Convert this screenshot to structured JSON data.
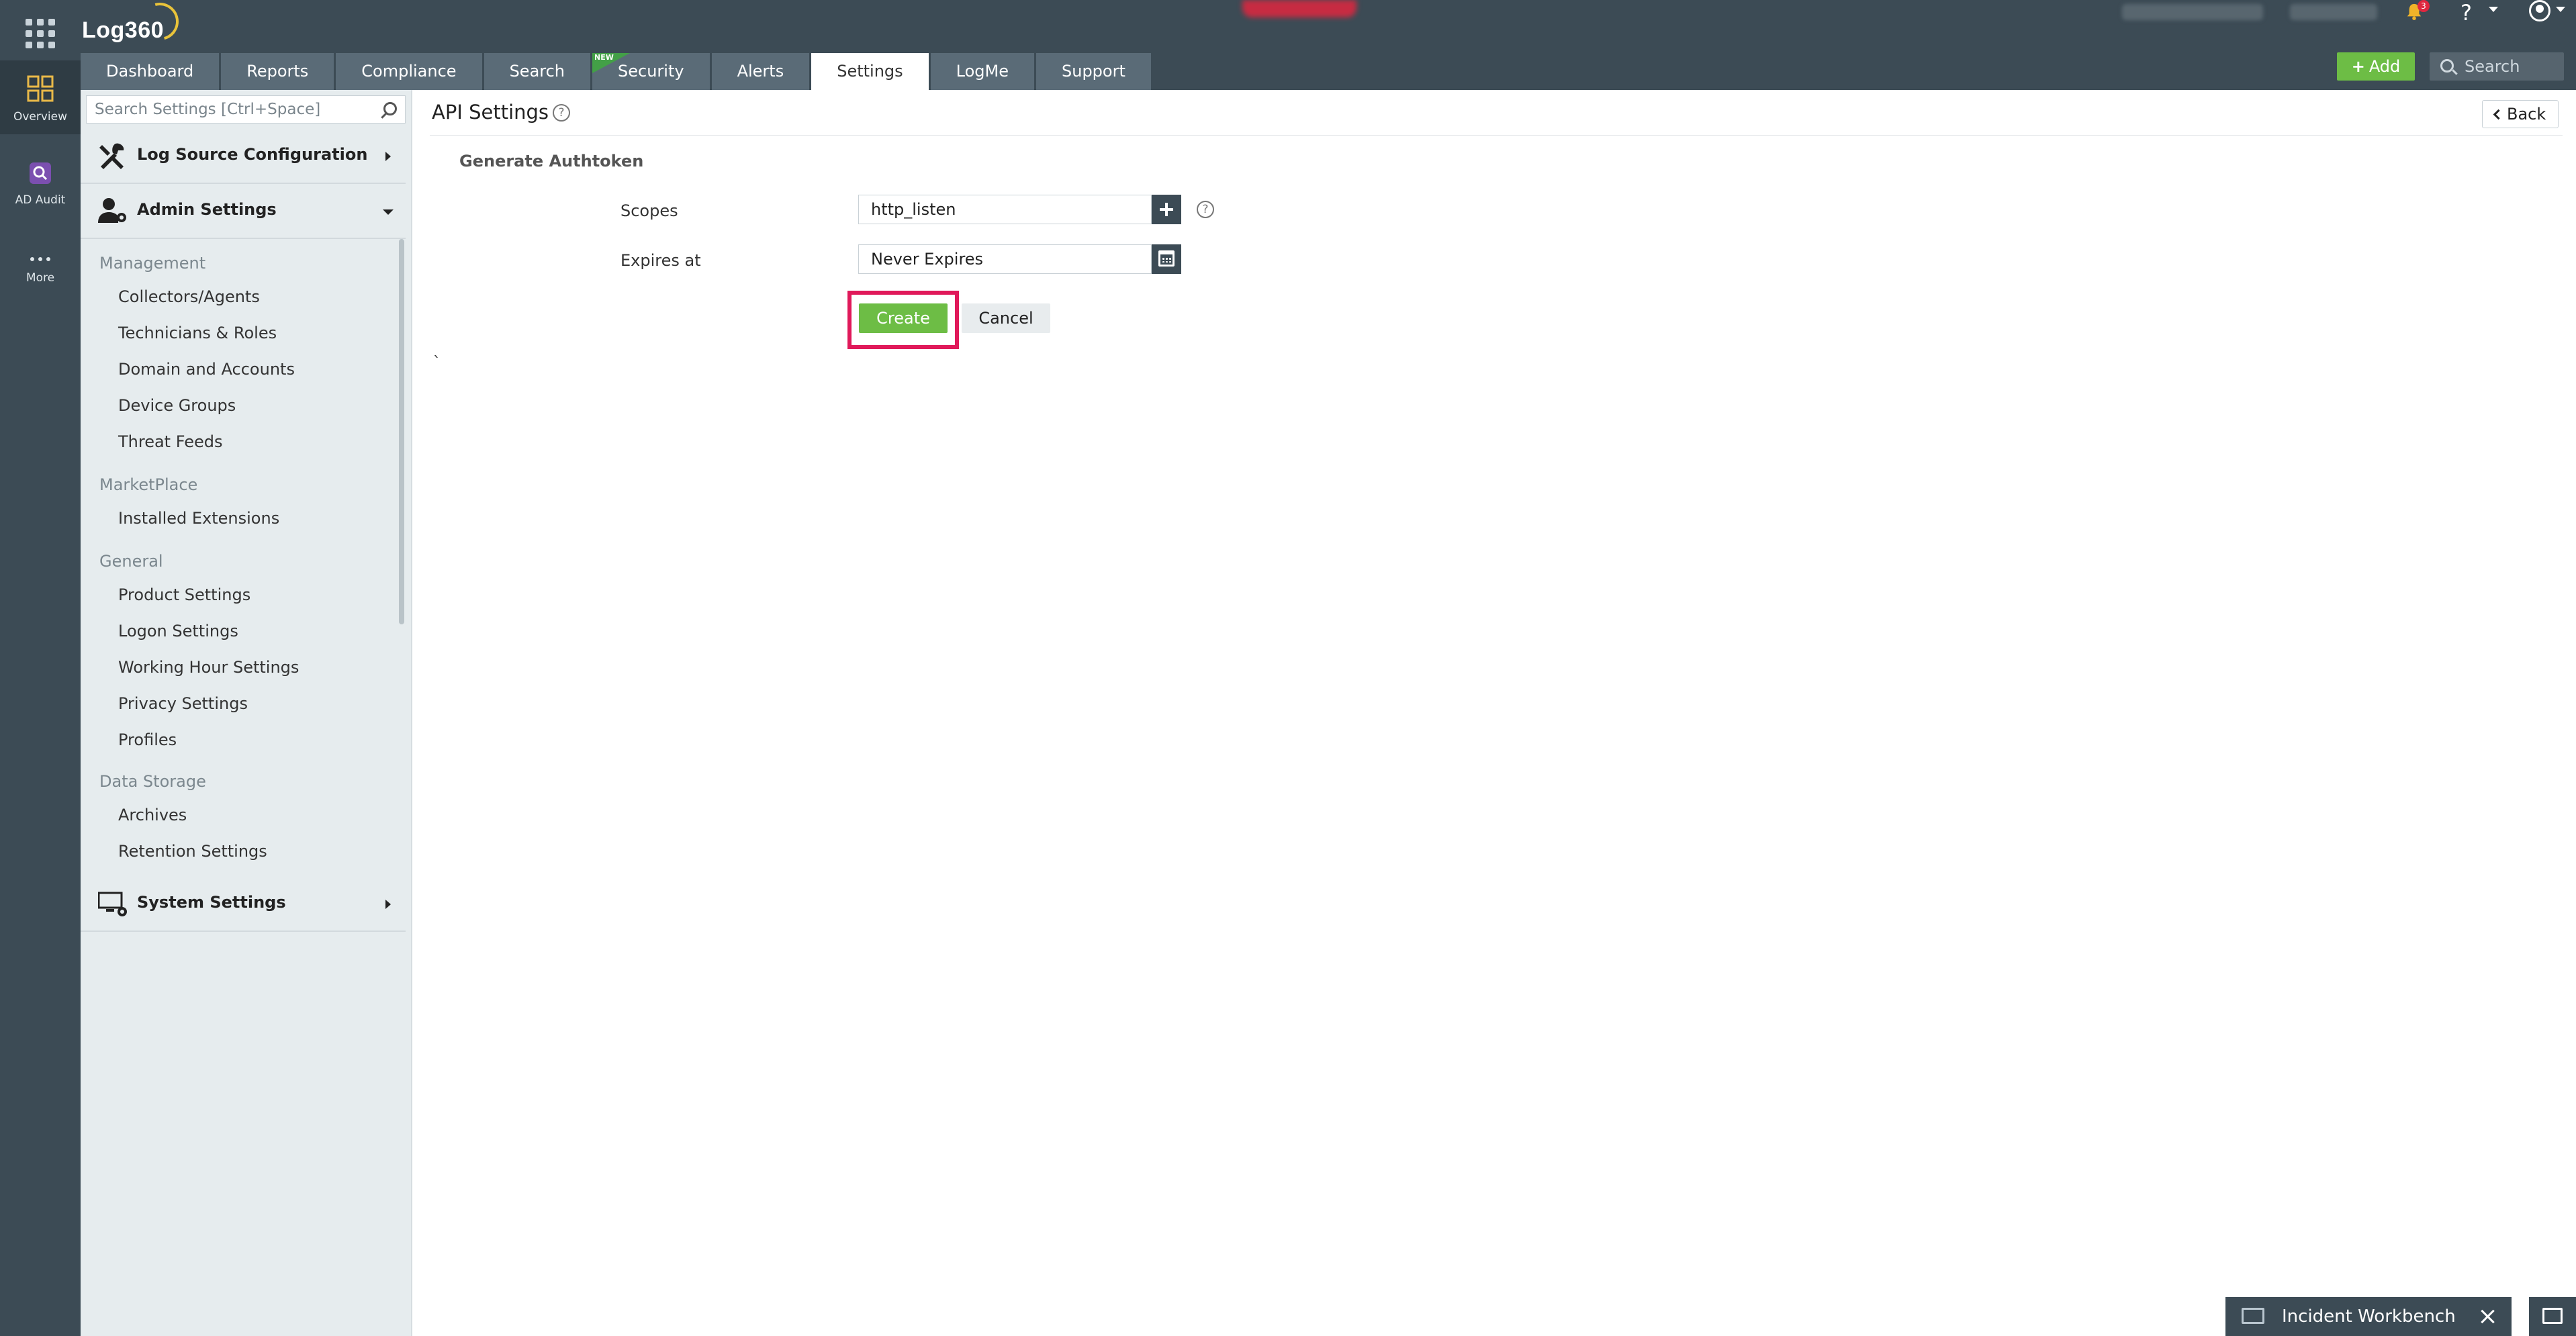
{
  "app": {
    "name": "Log360",
    "colors": {
      "header_bg": "#3c4b55",
      "tab_bg": "#5a6b77",
      "accent_green": "#6dbd45",
      "highlight_pink": "#e0195a",
      "sidebar_bg": "#e6ecee"
    }
  },
  "rail": {
    "items": [
      {
        "label": "Overview",
        "icon": "grid-dashboard-icon"
      },
      {
        "label": "AD Audit",
        "icon": "ad-audit-icon"
      },
      {
        "label": "More",
        "icon": "more-dots-icon"
      }
    ]
  },
  "topbar": {
    "notification_count": "3",
    "help_label": "?",
    "add_label": "Add",
    "search_placeholder": "Search",
    "tabs": [
      {
        "label": "Dashboard"
      },
      {
        "label": "Reports"
      },
      {
        "label": "Compliance"
      },
      {
        "label": "Search"
      },
      {
        "label": "Security",
        "badge": "NEW"
      },
      {
        "label": "Alerts"
      },
      {
        "label": "Settings",
        "active": true
      },
      {
        "label": "LogMe"
      },
      {
        "label": "Support"
      }
    ]
  },
  "sidebar": {
    "search_placeholder": "Search Settings [Ctrl+Space]",
    "sections": {
      "log_source": "Log Source Configuration",
      "admin": "Admin Settings",
      "system": "System Settings"
    },
    "groups": [
      {
        "label": "Management",
        "items": [
          "Collectors/Agents",
          "Technicians & Roles",
          "Domain and Accounts",
          "Device Groups",
          "Threat Feeds"
        ]
      },
      {
        "label": "MarketPlace",
        "items": [
          "Installed Extensions"
        ]
      },
      {
        "label": "General",
        "items": [
          "Product Settings",
          "Logon Settings",
          "Working Hour Settings",
          "Privacy Settings",
          "Profiles"
        ]
      },
      {
        "label": "Data Storage",
        "items": [
          "Archives",
          "Retention Settings"
        ]
      }
    ]
  },
  "main": {
    "title": "API Settings",
    "back_label": "Back",
    "form": {
      "title": "Generate Authtoken",
      "scopes_label": "Scopes",
      "scopes_value": "http_listen",
      "expires_label": "Expires at",
      "expires_value": "Never Expires",
      "create_label": "Create",
      "cancel_label": "Cancel"
    },
    "stray_mark": "`"
  },
  "bottom": {
    "incident_label": "Incident Workbench"
  }
}
